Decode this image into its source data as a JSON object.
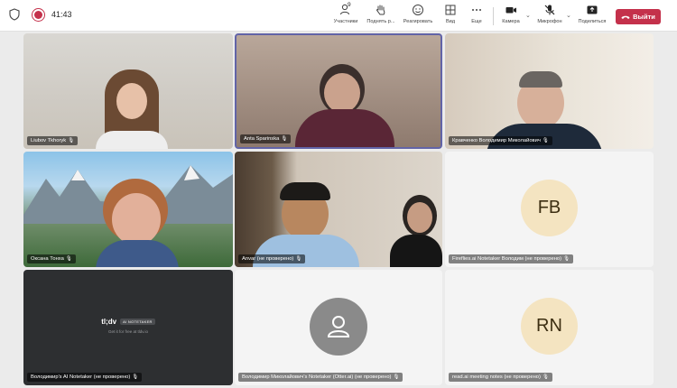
{
  "meeting": {
    "timer": "41:43"
  },
  "toolbar": {
    "participants_count": "9",
    "participants_label": "Участники",
    "raise_label": "Поднять р...",
    "react_label": "Реагировать",
    "view_label": "Вид",
    "more_label": "Еще",
    "camera_label": "Камера",
    "mic_label": "Микрофон",
    "share_label": "Поделиться",
    "leave_label": "Выйти"
  },
  "colors": {
    "leave": "#c4314b",
    "active_border": "#6264a7",
    "avatar_bg": "#f4e4c1"
  },
  "tiles": [
    {
      "name": "Liubov Tkhoryk",
      "type": "video"
    },
    {
      "name": "Anta Sparinska",
      "type": "video",
      "active": true
    },
    {
      "name": "Кравченко Володимир Миколайович",
      "type": "video"
    },
    {
      "name": "Оксана Тонха",
      "type": "video"
    },
    {
      "name": "Anvar (не проверено)",
      "type": "video"
    },
    {
      "name": "Fireflies.ai Notetaker Володим (не проверено)",
      "type": "avatar",
      "initials": "FB"
    },
    {
      "name": "Володимир's AI Notetaker (не проверено)",
      "type": "video",
      "brand": "tl;dv",
      "badge": "AI NOTETAKER",
      "tagline": "Get it for free at tldv.io"
    },
    {
      "name": "Володимир Миколайович's Notetaker (Otter.ai) (не проверено)",
      "type": "avatar",
      "icon": "person-icon"
    },
    {
      "name": "read.ai meeting notes (не проверено)",
      "type": "avatar",
      "initials": "RN"
    }
  ]
}
